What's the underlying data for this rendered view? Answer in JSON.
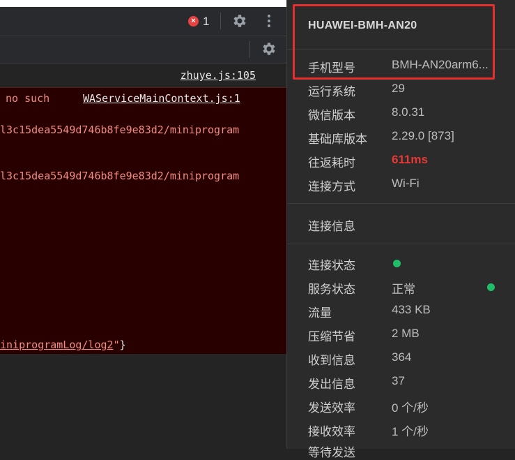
{
  "toolbar": {
    "error_count": "1",
    "error_badge_icon": "error-circle-icon"
  },
  "console": {
    "source_link_1": "zhuye.js:105",
    "error_line_1_text": "no such",
    "source_link_2": "WAServiceMainContext.js:1",
    "path_line_1": "l3c15dea5549d746b8fe9e83d2/miniprogram",
    "path_line_2": "l3c15dea5549d746b8fe9e83d2/miniprogram",
    "tail_link": "iniprogramLog/log2",
    "tail_suffix_quote": "\"",
    "tail_suffix_brace": "}"
  },
  "device": {
    "title": "HUAWEI-BMH-AN20",
    "rows": [
      {
        "key": "手机型号",
        "value": "BMH-AN20arm6..."
      },
      {
        "key": "运行系统",
        "value": "29"
      },
      {
        "key": "微信版本",
        "value": "8.0.31"
      },
      {
        "key": "基础库版本",
        "value": "2.29.0 [873]"
      },
      {
        "key": "往返耗时",
        "value": "611ms"
      },
      {
        "key": "连接方式",
        "value": "Wi-Fi"
      }
    ]
  },
  "connection": {
    "section_title": "连接信息",
    "status_label": "连接状态",
    "service_label": "服务状态",
    "service_value": "正常",
    "rows": [
      {
        "key": "流量",
        "value": "433 KB"
      },
      {
        "key": "压缩节省",
        "value": "2 MB"
      },
      {
        "key": "收到信息",
        "value": "364"
      },
      {
        "key": "发出信息",
        "value": "37"
      },
      {
        "key": "发送效率",
        "value": "0 个/秒"
      },
      {
        "key": "接收效率",
        "value": "1 个/秒"
      }
    ],
    "cut_off_text": "等待发送"
  },
  "colors": {
    "status_ok": "#1fbf6a",
    "rtt_warning": "#e53935",
    "error_bg": "#290000",
    "highlight": "#e53030"
  }
}
